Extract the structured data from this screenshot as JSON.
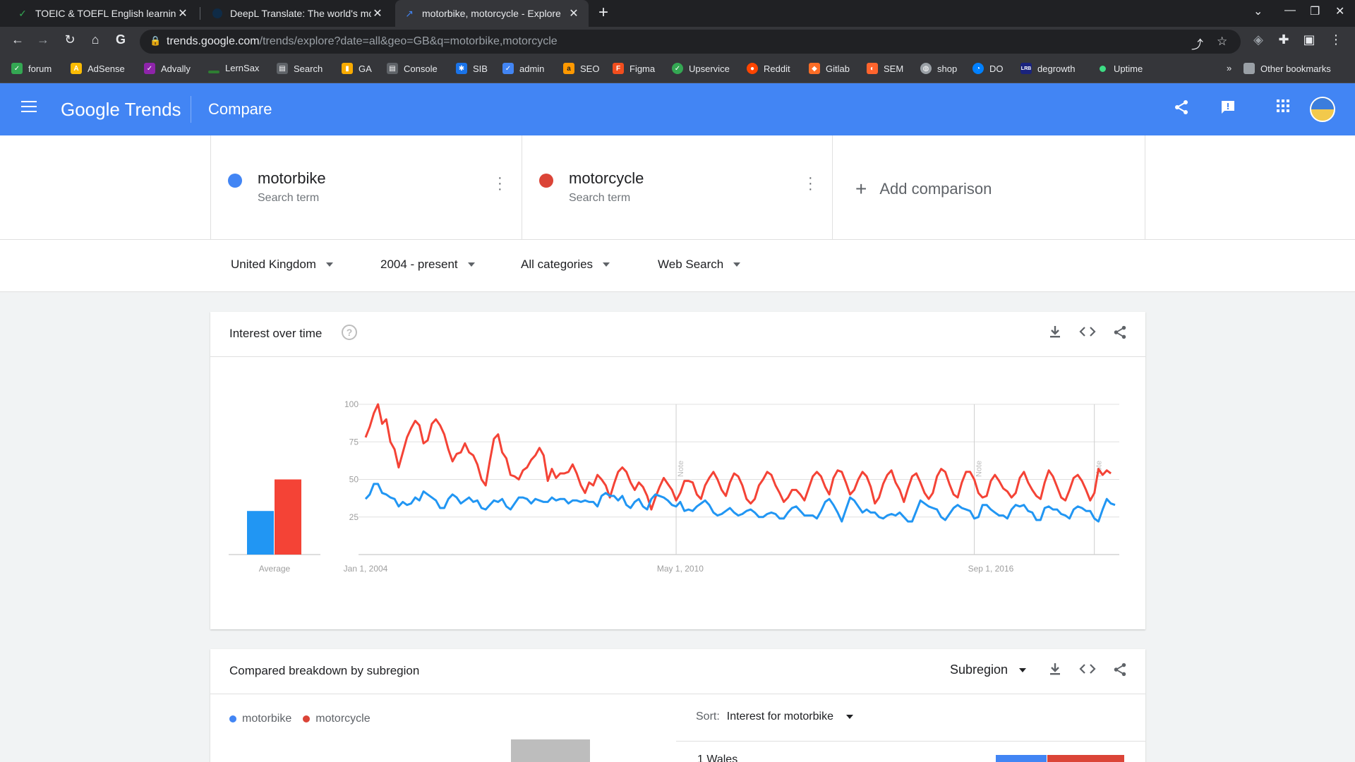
{
  "browser": {
    "tabs": [
      {
        "title": "TOEIC & TOEFL English learning",
        "active": false
      },
      {
        "title": "DeepL Translate: The world's mo",
        "active": false
      },
      {
        "title": "motorbike, motorcycle - Explore",
        "active": true
      }
    ],
    "url_host": "trends.google.com",
    "url_path": "/trends/explore?date=all&geo=GB&q=motorbike,motorcycle",
    "bookmarks": [
      "forum",
      "AdSense",
      "Advally",
      "LernSax",
      "Search",
      "GA",
      "Console",
      "SIB",
      "admin",
      "SEO",
      "Figma",
      "Upservice",
      "Reddit",
      "Gitlab",
      "SEM",
      "shop",
      "DO",
      "degrowth",
      "Uptime"
    ],
    "bookmarks_overflow": "»",
    "other_bookmarks": "Other bookmarks"
  },
  "header": {
    "logo": "Google Trends",
    "title": "Compare"
  },
  "terms": [
    {
      "name": "motorbike",
      "sub": "Search term",
      "color": "#4285f4"
    },
    {
      "name": "motorcycle",
      "sub": "Search term",
      "color": "#db4437"
    }
  ],
  "add_comparison": "Add comparison",
  "filters": {
    "region": "United Kingdom",
    "time": "2004 - present",
    "category": "All categories",
    "type": "Web Search"
  },
  "interest_card": {
    "title": "Interest over time",
    "help": "?",
    "average_label": "Average",
    "note_label": "Note"
  },
  "chart_data": {
    "type": "line",
    "y_ticks": [
      25,
      50,
      75,
      100
    ],
    "ylim": [
      0,
      100
    ],
    "x_ticks": [
      "Jan 1, 2004",
      "May 1, 2010",
      "Sep 1, 2016"
    ],
    "average": {
      "motorbike": 29,
      "motorcycle": 50
    },
    "series": [
      {
        "name": "motorbike",
        "color": "#2196f3",
        "values": [
          37,
          40,
          47,
          47,
          41,
          40,
          38,
          37,
          32,
          35,
          33,
          34,
          38,
          36,
          42,
          40,
          38,
          36,
          31,
          31,
          37,
          40,
          38,
          34,
          36,
          38,
          35,
          36,
          31,
          30,
          33,
          36,
          35,
          37,
          32,
          30,
          34,
          38,
          38,
          37,
          34,
          37,
          36,
          35,
          35,
          38,
          36,
          37,
          37,
          34,
          36,
          36,
          35,
          36,
          35,
          35,
          32,
          39,
          41,
          39,
          39,
          36,
          39,
          33,
          31,
          35,
          37,
          32,
          30,
          37,
          40,
          39,
          38,
          36,
          33,
          32,
          35,
          29,
          30,
          29,
          32,
          34,
          36,
          33,
          28,
          26,
          27,
          29,
          31,
          28,
          26,
          27,
          29,
          30,
          28,
          25,
          25,
          27,
          28,
          27,
          24,
          24,
          28,
          31,
          32,
          29,
          26,
          26,
          26,
          24,
          29,
          35,
          37,
          33,
          28,
          22,
          30,
          38,
          36,
          32,
          28,
          30,
          28,
          28,
          25,
          24,
          26,
          27,
          26,
          28,
          25,
          22,
          22,
          29,
          36,
          34,
          32,
          31,
          30,
          25,
          23,
          27,
          31,
          33,
          31,
          30,
          29,
          24,
          25,
          33,
          33,
          30,
          28,
          26,
          26,
          24,
          30,
          33,
          32,
          33,
          29,
          28,
          23,
          23,
          31,
          32,
          30,
          30,
          27,
          26,
          24,
          30,
          32,
          31,
          29,
          29,
          24,
          22,
          30,
          37,
          34,
          33
        ]
      },
      {
        "name": "motorcycle",
        "color": "#f44336",
        "values": [
          78,
          85,
          94,
          100,
          87,
          90,
          75,
          70,
          58,
          68,
          78,
          84,
          89,
          86,
          74,
          76,
          87,
          90,
          86,
          80,
          70,
          62,
          67,
          68,
          74,
          68,
          66,
          60,
          50,
          46,
          62,
          77,
          80,
          68,
          64,
          53,
          52,
          50,
          56,
          58,
          63,
          66,
          71,
          66,
          49,
          57,
          51,
          54,
          54,
          55,
          60,
          54,
          46,
          41,
          48,
          46,
          53,
          50,
          46,
          38,
          47,
          55,
          58,
          55,
          48,
          43,
          48,
          45,
          39,
          30,
          38,
          45,
          51,
          47,
          43,
          36,
          41,
          49,
          49,
          48,
          40,
          37,
          46,
          51,
          55,
          50,
          43,
          39,
          48,
          54,
          52,
          46,
          37,
          34,
          37,
          46,
          50,
          55,
          53,
          46,
          41,
          35,
          38,
          43,
          43,
          40,
          36,
          44,
          52,
          55,
          52,
          45,
          40,
          51,
          56,
          55,
          48,
          40,
          43,
          50,
          55,
          52,
          45,
          34,
          38,
          47,
          53,
          56,
          48,
          43,
          35,
          44,
          52,
          54,
          48,
          41,
          37,
          41,
          52,
          57,
          55,
          47,
          40,
          38,
          48,
          55,
          55,
          50,
          41,
          38,
          39,
          49,
          53,
          49,
          44,
          42,
          38,
          41,
          51,
          55,
          48,
          43,
          39,
          37,
          48,
          56,
          52,
          45,
          38,
          36,
          43,
          51,
          53,
          49,
          43,
          36,
          41,
          57,
          53,
          56,
          54
        ]
      }
    ]
  },
  "subregion_card": {
    "title": "Compared breakdown by subregion",
    "dropdown": "Subregion",
    "legend": [
      "motorbike",
      "motorcycle"
    ],
    "sort_label": "Sort:",
    "sort_value": "Interest for motorbike",
    "first_row": "1   Wales"
  }
}
